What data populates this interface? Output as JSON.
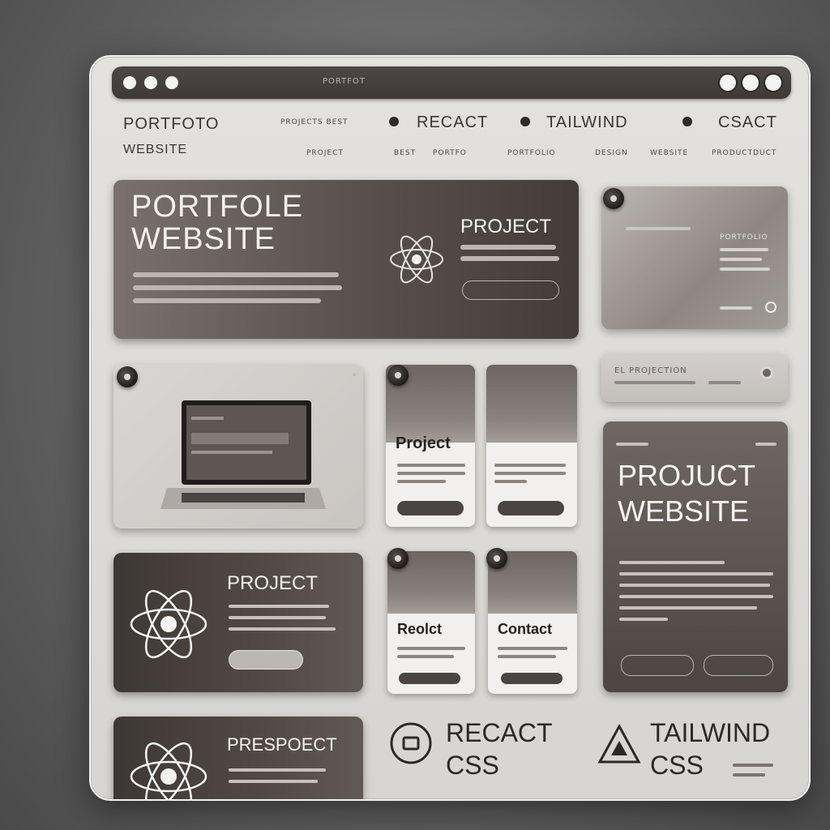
{
  "titlebar": {
    "label": "PORTFOT"
  },
  "nav": {
    "brand_line1": "PORTFOTO",
    "brand_line2": "WEBSITE",
    "link_blurred": "PROJECTS BEST",
    "link_react": "RECACT",
    "link_tailwind": "TAILWIND",
    "link_contact": "CSACT",
    "sub_links": [
      "PROJECT",
      "BEST",
      "PORTFO",
      "PORTFOLIO",
      "DESIGN",
      "WEBSITE",
      "PRODUCTDUCT"
    ]
  },
  "hero": {
    "title_line1": "PORTFOLE",
    "title_line2": "WEBSITE",
    "side_title": "PROJECT",
    "button_label": ""
  },
  "side_panel": {
    "heading": "PORTFOLIO"
  },
  "search_bar": {
    "label": "EL PROJECTION"
  },
  "project_cards": [
    {
      "title": "Project"
    },
    {
      "title": ""
    },
    {
      "title": "Reolct"
    },
    {
      "title": "Contact"
    }
  ],
  "project_website_card": {
    "title_line1": "PROJUCT",
    "title_line2": "WEBSITE"
  },
  "project_card": {
    "title": "PROJECT"
  },
  "prespect_card": {
    "title": "PRESPOECT"
  },
  "bottom": {
    "react_line1": "RECACT",
    "react_line2": "CSS",
    "tailwind_line1": "TAILWIND",
    "tailwind_line2": "CSS"
  },
  "colors": {
    "dark_card": "#4a433f",
    "window_bg": "#dedcd9",
    "accent_light": "#f4f4f4"
  },
  "icons": [
    "atom-icon",
    "laptop-icon",
    "pin-icon",
    "react-box-icon",
    "triangle-logo-icon",
    "window-dot-icon"
  ]
}
